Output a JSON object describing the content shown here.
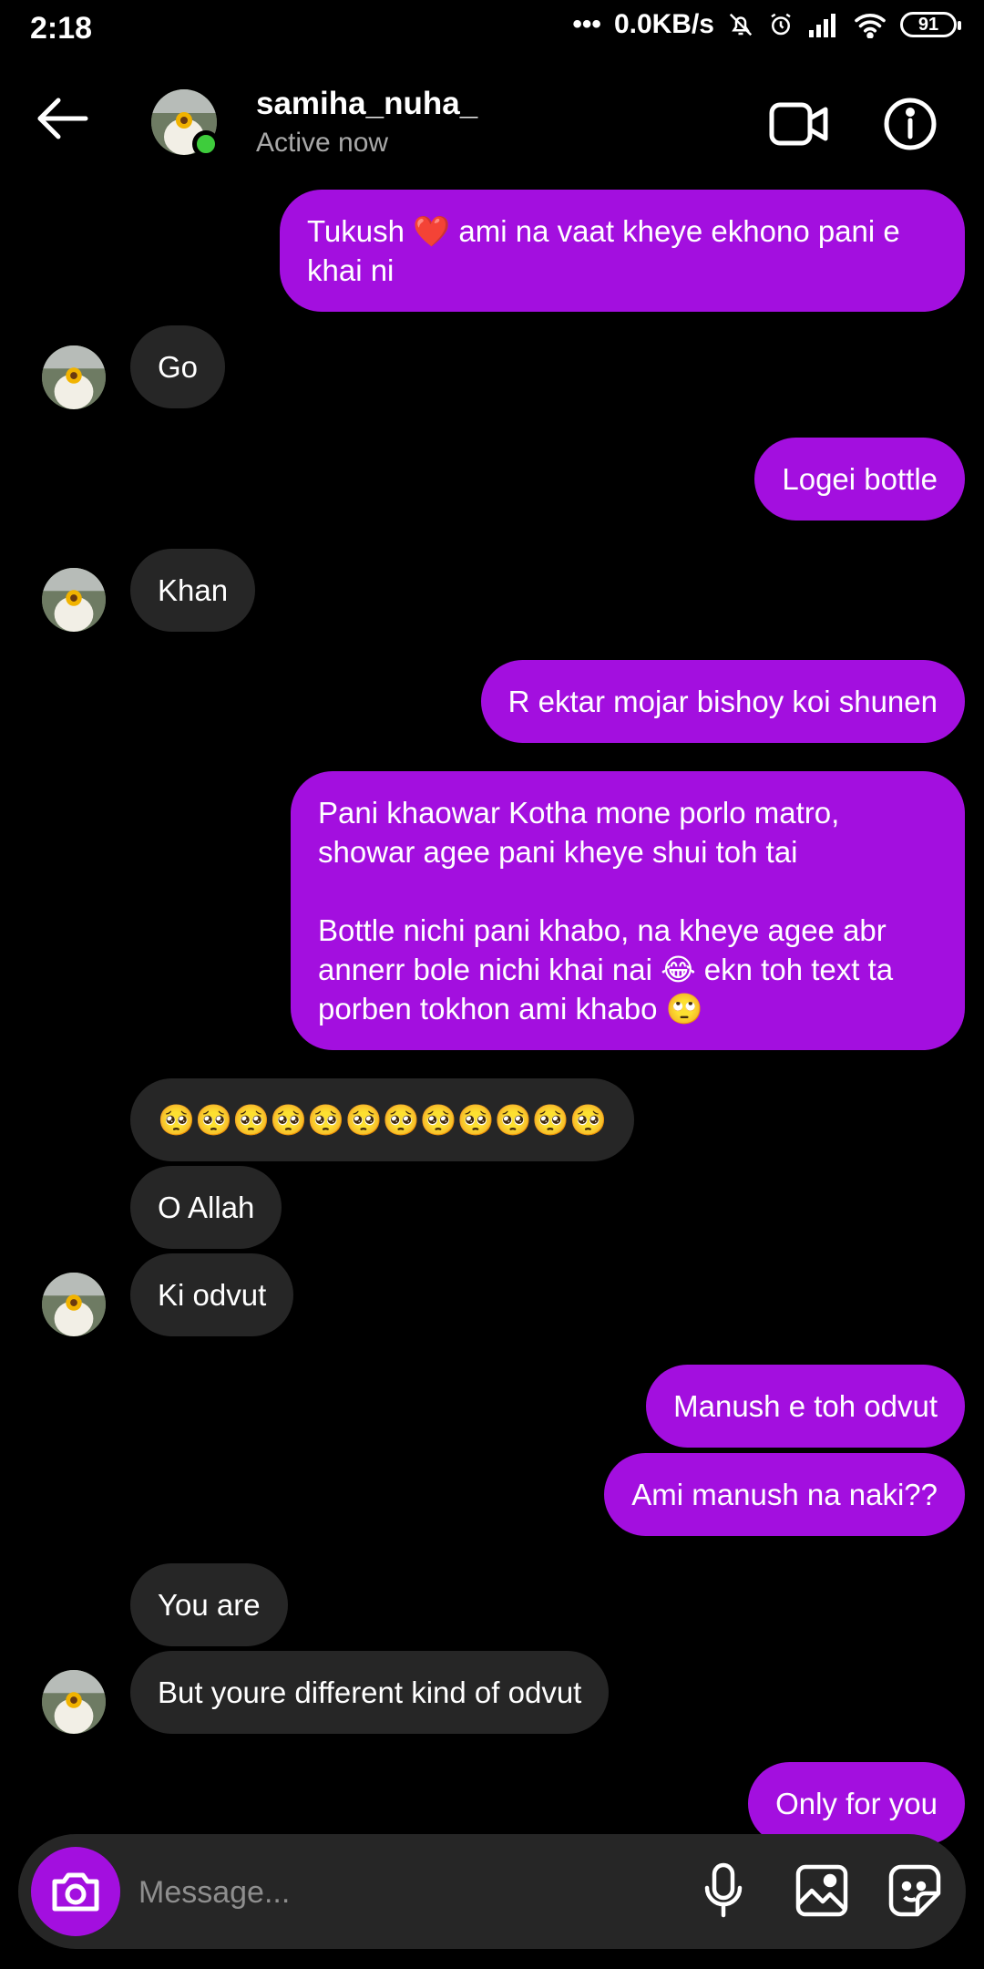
{
  "status_bar": {
    "time": "2:18",
    "network_speed": "0.0KB/s",
    "battery": "91"
  },
  "header": {
    "username": "samiha_nuha_",
    "status": "Active now"
  },
  "messages": [
    {
      "side": "out",
      "text": "Tukush ❤️ ami na vaat kheye ekhono pani e\nkhai ni"
    },
    {
      "side": "in",
      "text": "Go"
    },
    {
      "side": "out",
      "text": "Logei bottle"
    },
    {
      "side": "in",
      "text": "Khan"
    },
    {
      "side": "out",
      "text": "R ektar mojar bishoy koi shunen"
    },
    {
      "side": "out",
      "text": "Pani khaowar Kotha mone porlo matro,\nshowar agee pani kheye shui toh tai\n\nBottle nichi pani khabo, na kheye agee abr\nannerr bole nichi khai nai 😂 ekn toh text ta\nporben tokhon ami khabo 🙄"
    },
    {
      "side": "in",
      "text": "🥺🥺🥺🥺🥺🥺🥺🥺🥺🥺🥺🥺"
    },
    {
      "side": "in",
      "text": "O Allah"
    },
    {
      "side": "in",
      "text": "Ki odvut"
    },
    {
      "side": "out",
      "text": "Manush e toh odvut"
    },
    {
      "side": "out",
      "text": "Ami manush na naki??"
    },
    {
      "side": "in",
      "text": "You are"
    },
    {
      "side": "in",
      "text": "But youre different kind of odvut"
    },
    {
      "side": "out",
      "text": "Only for you"
    }
  ],
  "composer": {
    "placeholder": "Message..."
  },
  "icons": {
    "back": "back-arrow-icon",
    "video": "video-call-icon",
    "info": "info-icon",
    "camera": "camera-icon",
    "mic": "microphone-icon",
    "gallery": "gallery-icon",
    "sticker": "sticker-icon"
  },
  "colors": {
    "background": "#000000",
    "outgoing_bubble": "#a30fdf",
    "incoming_bubble": "#262626",
    "online_dot": "#3ecc3c"
  }
}
